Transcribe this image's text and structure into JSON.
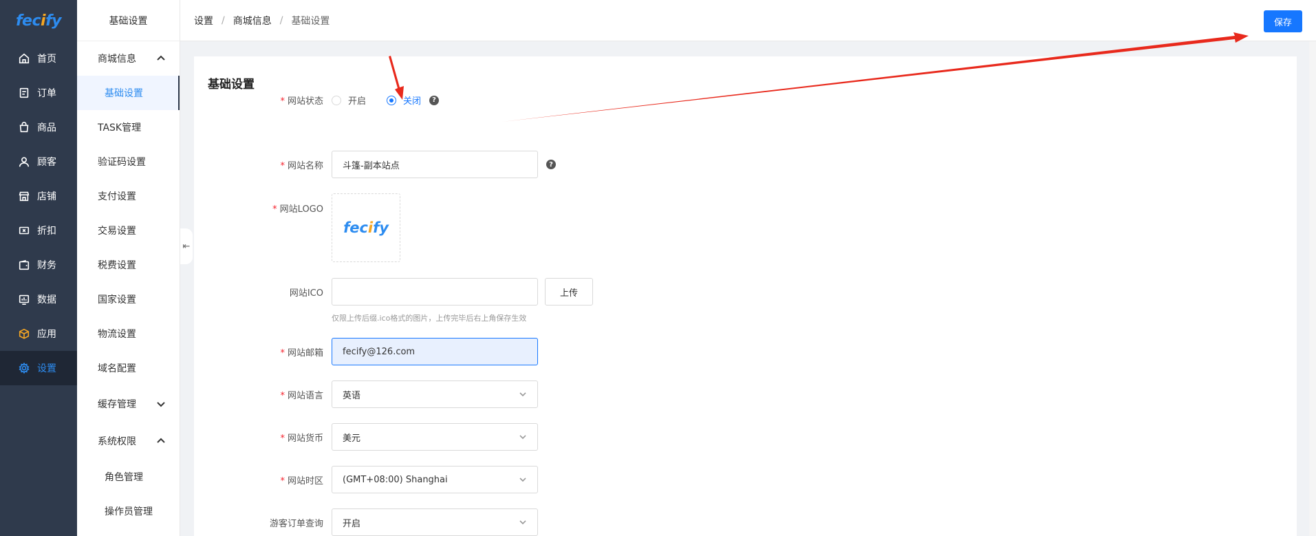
{
  "nav": {
    "logo_main": "fec",
    "logo_accent": "i",
    "logo_end": "fy",
    "items": [
      {
        "label": "首页",
        "icon": "home-icon"
      },
      {
        "label": "订单",
        "icon": "order-icon"
      },
      {
        "label": "商品",
        "icon": "product-bag-icon"
      },
      {
        "label": "顾客",
        "icon": "user-icon"
      },
      {
        "label": "店铺",
        "icon": "store-icon"
      },
      {
        "label": "折扣",
        "icon": "ticket-icon"
      },
      {
        "label": "财务",
        "icon": "wallet-icon"
      },
      {
        "label": "数据",
        "icon": "chart-icon"
      },
      {
        "label": "应用",
        "icon": "box-icon"
      },
      {
        "label": "设置",
        "icon": "gear-icon"
      }
    ]
  },
  "sub": {
    "title": "基础设置",
    "items": [
      {
        "label": "商城信息"
      },
      {
        "label": "基础设置"
      },
      {
        "label": "TASK管理"
      },
      {
        "label": "验证码设置"
      },
      {
        "label": "支付设置"
      },
      {
        "label": "交易设置"
      },
      {
        "label": "税费设置"
      },
      {
        "label": "国家设置"
      },
      {
        "label": "物流设置"
      },
      {
        "label": "域名配置"
      },
      {
        "label": "缓存管理"
      },
      {
        "label": "系统权限"
      },
      {
        "label": "角色管理"
      },
      {
        "label": "操作员管理"
      }
    ]
  },
  "header": {
    "crumbs": [
      "设置",
      "商城信息",
      "基础设置"
    ],
    "separator": "/",
    "save_label": "保存"
  },
  "form": {
    "title": "基础设置",
    "status": {
      "label": "网站状态",
      "options": [
        "开启",
        "关闭"
      ],
      "selected": "关闭"
    },
    "name": {
      "label": "网站名称",
      "value": "斗篷-副本站点"
    },
    "logo": {
      "label": "网站LOGO"
    },
    "ico": {
      "label": "网站ICO",
      "value": "",
      "upload_label": "上传",
      "hint": "仅限上传后缀.ico格式的图片，上传完毕后右上角保存生效"
    },
    "email": {
      "label": "网站邮箱",
      "value": "fecify@126.com"
    },
    "language": {
      "label": "网站语言",
      "value": "英语"
    },
    "currency": {
      "label": "网站货币",
      "value": "美元"
    },
    "timezone": {
      "label": "网站时区",
      "value": "(GMT+08:00) Shanghai"
    },
    "guest_order": {
      "label": "游客订单查询",
      "value": "开启"
    },
    "required_mark": "*",
    "help_mark": "?"
  },
  "colors": {
    "nav_bg": "#2f3a4c",
    "accent": "#1677ff",
    "annotation_arrow": "#e8291c"
  }
}
